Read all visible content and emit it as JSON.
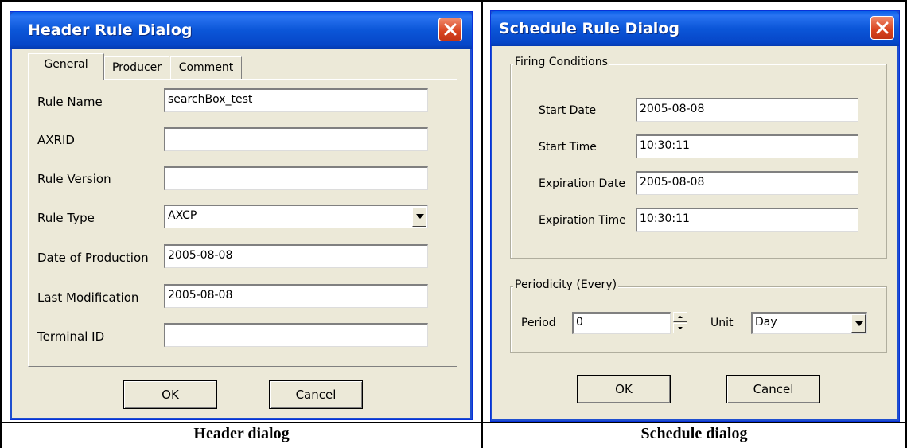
{
  "captions": {
    "left": "Header dialog",
    "right": "Schedule dialog"
  },
  "header_dialog": {
    "title": "Header Rule Dialog",
    "close_icon": "close-x-icon",
    "tabs": [
      "General",
      "Producer",
      "Comment"
    ],
    "fields": {
      "rule_name": {
        "label": "Rule Name",
        "value": "searchBox_test"
      },
      "axrid": {
        "label": "AXRID",
        "value": ""
      },
      "rule_version": {
        "label": "Rule Version",
        "value": ""
      },
      "rule_type": {
        "label": "Rule Type",
        "value": "AXCP"
      },
      "date_of_production": {
        "label": "Date of Production",
        "value": "2005-08-08"
      },
      "last_modification": {
        "label": "Last Modification",
        "value": "2005-08-08"
      },
      "terminal_id": {
        "label": "Terminal ID",
        "value": ""
      }
    },
    "ok_label": "OK",
    "cancel_label": "Cancel"
  },
  "schedule_dialog": {
    "title": "Schedule Rule Dialog",
    "close_icon": "close-x-icon",
    "firing_group_label": "Firing Conditions",
    "fields": {
      "start_date": {
        "label": "Start Date",
        "value": "2005-08-08"
      },
      "start_time": {
        "label": "Start Time",
        "value": "10:30:11"
      },
      "expiration_date": {
        "label": "Expiration Date",
        "value": "2005-08-08"
      },
      "expiration_time": {
        "label": "Expiration Time",
        "value": "10:30:11"
      }
    },
    "periodicity_group_label": "Periodicity (Every)",
    "period": {
      "label": "Period",
      "value": "0"
    },
    "unit": {
      "label": "Unit",
      "value": "Day"
    },
    "ok_label": "OK",
    "cancel_label": "Cancel"
  },
  "colors": {
    "titlebar": "#0b56d8",
    "dialog_bg": "#ece9d8",
    "close_button": "#d8431f"
  }
}
